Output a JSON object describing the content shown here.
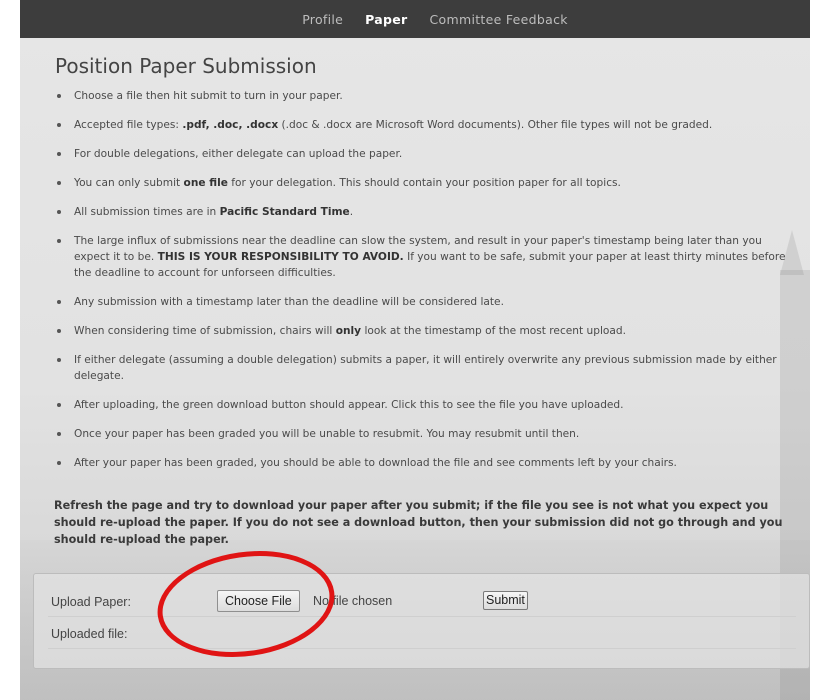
{
  "nav": {
    "items": [
      {
        "label": "Profile"
      },
      {
        "label": "Paper",
        "active": true
      },
      {
        "label": "Committee Feedback"
      }
    ]
  },
  "page": {
    "title": "Position Paper Submission"
  },
  "rules": [
    {
      "parts": [
        "Choose a file then hit submit to turn in your paper."
      ]
    },
    {
      "parts": [
        "Accepted file types: ",
        "**.pdf, .doc, .docx",
        " (.doc & .docx are Microsoft Word documents). Other file types will not be graded."
      ]
    },
    {
      "parts": [
        "For double delegations, either delegate can upload the paper."
      ]
    },
    {
      "parts": [
        "You can only submit ",
        "**one file",
        " for your delegation. This should contain your position paper for all topics."
      ]
    },
    {
      "parts": [
        "All submission times are in ",
        "**Pacific Standard Time",
        "."
      ]
    },
    {
      "parts": [
        "The large influx of submissions near the deadline can slow the system, and result in your paper's timestamp being later than you expect it to be. ",
        "**THIS IS YOUR RESPONSIBILITY TO AVOID.",
        " If you want to be safe, submit your paper at least thirty minutes before the deadline to account for unforseen difficulties."
      ]
    },
    {
      "parts": [
        "Any submission with a timestamp later than the deadline will be considered late."
      ]
    },
    {
      "parts": [
        "When considering time of submission, chairs will ",
        "**only",
        " look at the timestamp of the most recent upload."
      ]
    },
    {
      "parts": [
        "If either delegate (assuming a double delegation) submits a paper, it will entirely overwrite any previous submission made by either delegate."
      ]
    },
    {
      "parts": [
        "After uploading, the green download button should appear. Click this to see the file you have uploaded."
      ]
    },
    {
      "parts": [
        "Once your paper has been graded you will be unable to resubmit. You may resubmit until then."
      ]
    },
    {
      "parts": [
        "After your paper has been graded, you should be able to download the file and see comments left by your chairs."
      ]
    }
  ],
  "refresh_note": "Refresh the page and try to download your paper after you submit; if the file you see is not what you expect you should re-upload the paper. If you do not see a download button, then your submission did not go through and you should re-upload the paper.",
  "upload": {
    "upload_label": "Upload Paper:",
    "choose_file_label": "Choose File",
    "file_status": "No file chosen",
    "submit_label": "Submit",
    "uploaded_label": "Uploaded file:"
  },
  "colors": {
    "navbar": "#3d3d3d",
    "annotation_circle": "#e01414"
  }
}
